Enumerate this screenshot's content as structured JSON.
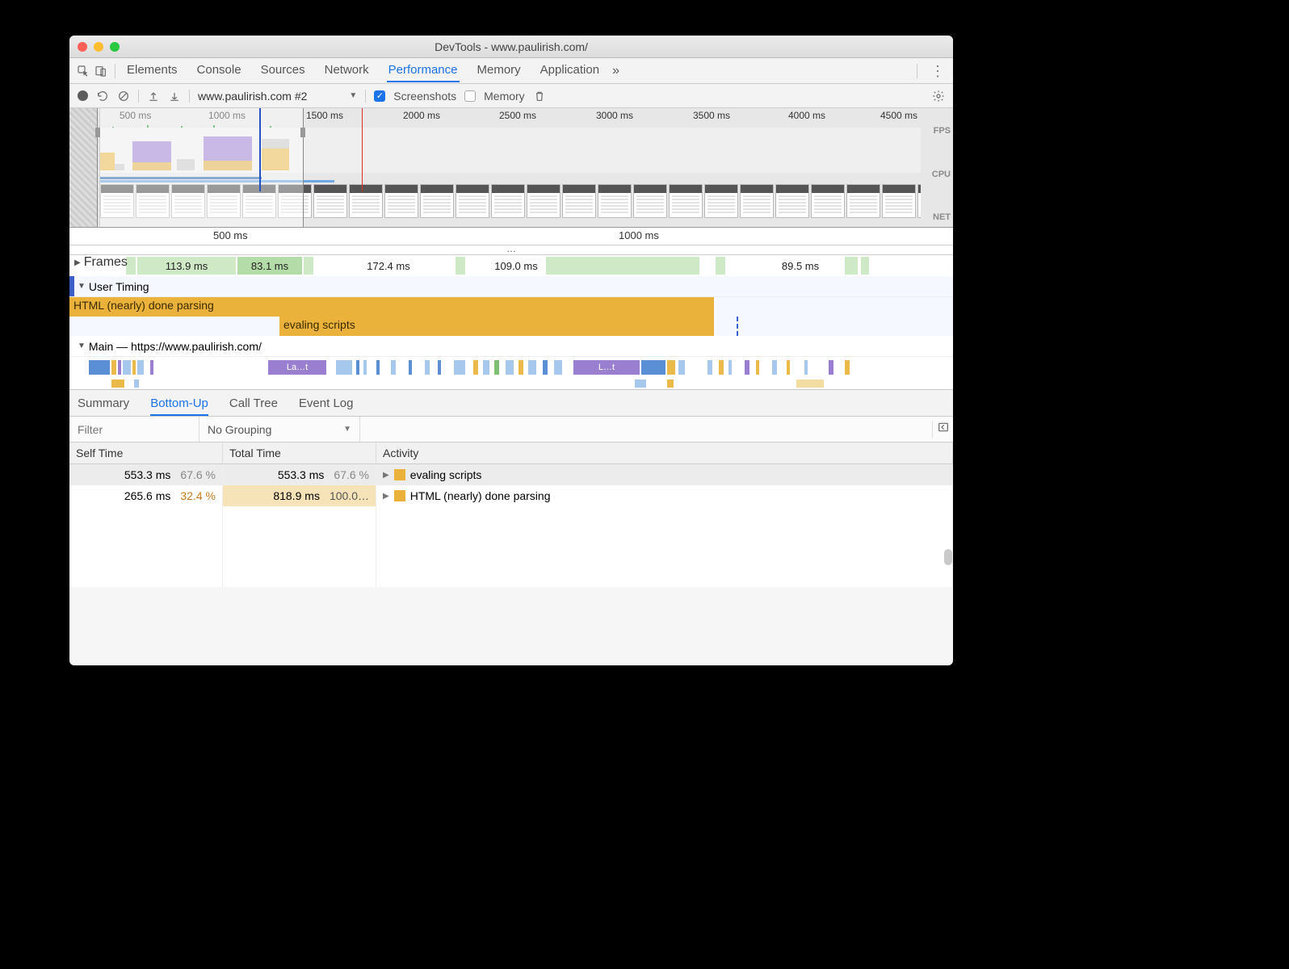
{
  "window": {
    "title": "DevTools - www.paulirish.com/"
  },
  "tabs": {
    "items": [
      "Elements",
      "Console",
      "Sources",
      "Network",
      "Performance",
      "Memory",
      "Application"
    ],
    "active": "Performance",
    "overflow": "»"
  },
  "toolbar": {
    "profile_label": "www.paulirish.com #2",
    "screenshots_label": "Screenshots",
    "screenshots_checked": true,
    "memory_label": "Memory",
    "memory_checked": false
  },
  "overview": {
    "ticks": [
      "500 ms",
      "1000 ms",
      "1500 ms",
      "2000 ms",
      "2500 ms",
      "3000 ms",
      "3500 ms",
      "4000 ms",
      "4500 ms"
    ],
    "right_labels": {
      "fps": "FPS",
      "cpu": "CPU",
      "net": "NET"
    }
  },
  "ruler": {
    "ticks": [
      "500 ms",
      "1000 ms"
    ]
  },
  "dots": "…",
  "frames": {
    "label": "Frames",
    "segments": [
      "113.9 ms",
      "83.1 ms",
      "172.4 ms",
      "109.0 ms",
      "89.5 ms"
    ]
  },
  "user_timing": {
    "label": "User Timing",
    "bars": [
      "HTML (nearly) done parsing",
      "evaling scripts"
    ]
  },
  "main": {
    "label": "Main — https://www.paulirish.com/",
    "chunk1": "La…t",
    "chunk2": "L…t"
  },
  "details_tabs": {
    "items": [
      "Summary",
      "Bottom-Up",
      "Call Tree",
      "Event Log"
    ],
    "active": "Bottom-Up"
  },
  "filter": {
    "placeholder": "Filter",
    "grouping": "No Grouping"
  },
  "table": {
    "headers": [
      "Self Time",
      "Total Time",
      "Activity"
    ],
    "rows": [
      {
        "self_ms": "553.3 ms",
        "self_pct": "67.6 %",
        "total_ms": "553.3 ms",
        "total_pct": "67.6 %",
        "activity": "evaling scripts"
      },
      {
        "self_ms": "265.6 ms",
        "self_pct": "32.4 %",
        "total_ms": "818.9 ms",
        "total_pct": "100.0…",
        "activity": "HTML (nearly) done parsing"
      }
    ]
  }
}
